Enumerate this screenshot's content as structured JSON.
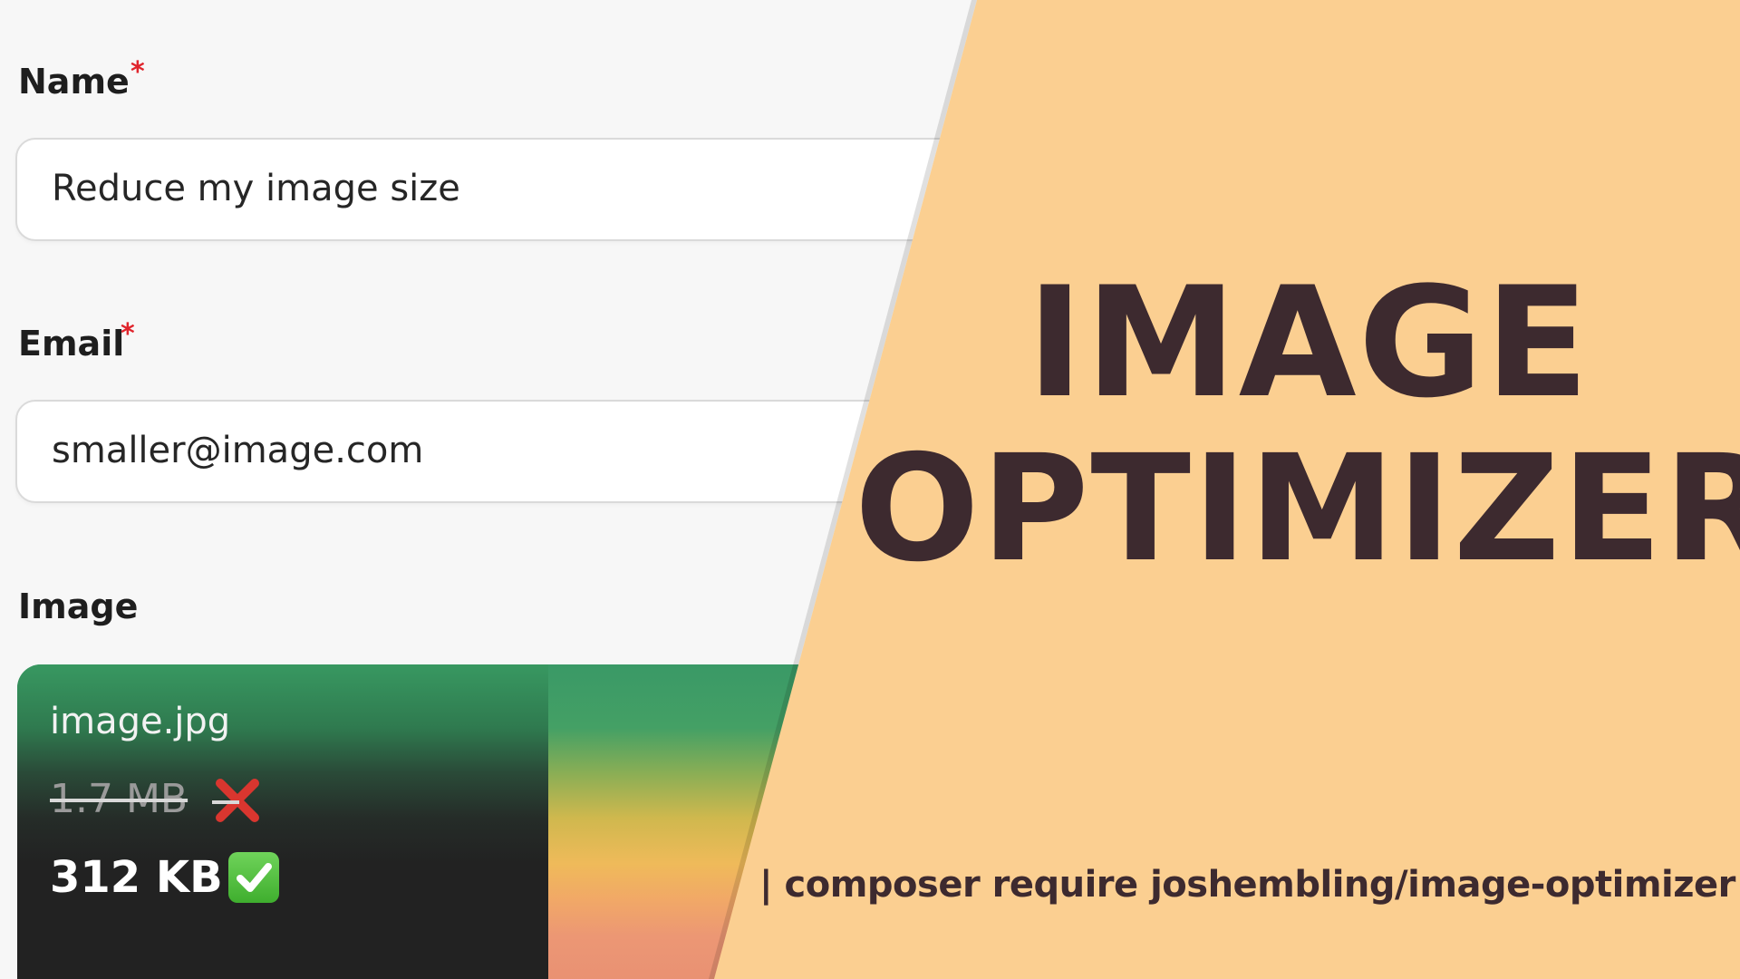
{
  "form": {
    "name": {
      "label": "Name",
      "required_marker": "*",
      "value": "Reduce my image size"
    },
    "email": {
      "label": "Email",
      "required_marker": "*",
      "value": "smaller@image.com"
    },
    "image": {
      "label": "Image",
      "file_name": "image.jpg",
      "original_size": "1.7 MB",
      "optimized_size": "312 KB"
    }
  },
  "banner": {
    "title_line_1": "IMAGE",
    "title_line_2": "OPTIMIZER",
    "command": "| composer require joshembling/image-optimizer"
  },
  "icons": {
    "rejected": "cross-mark-icon",
    "accepted": "check-mark-icon"
  },
  "colors": {
    "banner_background": "#fbcf91",
    "title_text": "#3d2a2f",
    "required_asterisk": "#e0242c",
    "panel_green": "#389861"
  }
}
